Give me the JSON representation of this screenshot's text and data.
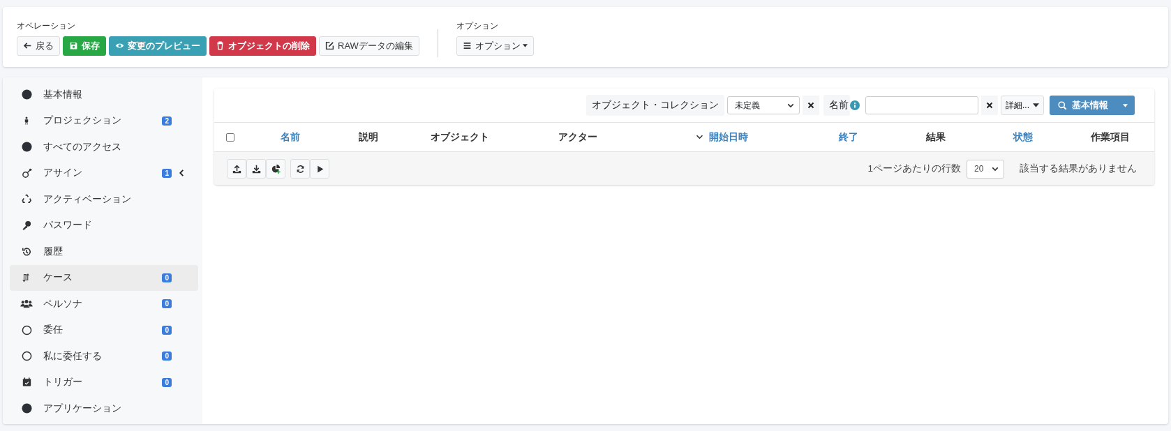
{
  "operations": {
    "label": "オペレーション",
    "buttons": [
      {
        "label": "戻る",
        "kind": "back"
      },
      {
        "label": "保存",
        "kind": "save"
      },
      {
        "label": "変更のプレビュー",
        "kind": "preview"
      },
      {
        "label": "オブジェクトの削除",
        "kind": "delete"
      },
      {
        "label": "RAWデータの編集",
        "kind": "edit"
      }
    ]
  },
  "options": {
    "label": "オプション",
    "button": "オプション"
  },
  "sidebar": {
    "items": [
      {
        "label": "基本情報",
        "selected": false
      },
      {
        "label": "プロジェクション",
        "selected": false,
        "badge": "2"
      },
      {
        "label": "すべてのアクセス",
        "selected": false
      },
      {
        "label": "アサイン",
        "selected": false,
        "badge": "1",
        "expanded": false
      },
      {
        "label": "アクティベーション",
        "selected": false
      },
      {
        "label": "パスワード",
        "selected": false
      },
      {
        "label": "履歴",
        "selected": false
      },
      {
        "label": "ケース",
        "selected": true,
        "badge": "0"
      },
      {
        "label": "ペルソナ",
        "selected": false,
        "badge": "0"
      },
      {
        "label": "委任",
        "selected": false,
        "badge": "0"
      },
      {
        "label": "私に委任する",
        "selected": false,
        "badge": "0"
      },
      {
        "label": "トリガー",
        "selected": false,
        "badge": "0"
      },
      {
        "label": "アプリケーション",
        "selected": false
      }
    ]
  },
  "search": {
    "collection_label": "オブジェクト・コレクション",
    "collection_value": "未定義",
    "name_label": "名前",
    "more_button": "詳細...",
    "search_button": "基本情報"
  },
  "table": {
    "select_all_checked": false,
    "columns": [
      {
        "label": "名前",
        "sortable": true,
        "sorted": false
      },
      {
        "label": "説明",
        "sortable": false,
        "sorted": false
      },
      {
        "label": "オブジェクト",
        "sortable": false,
        "sorted": false
      },
      {
        "label": "アクター",
        "sortable": false,
        "sorted": false
      },
      {
        "label": "開始日時",
        "sortable": true,
        "sorted": true
      },
      {
        "label": "終了",
        "sortable": true,
        "sorted": false
      },
      {
        "label": "結果",
        "sortable": false,
        "sorted": false
      },
      {
        "label": "状態",
        "sortable": true,
        "sorted": false
      },
      {
        "label": "作業項目",
        "sortable": false,
        "sorted": false
      }
    ]
  },
  "footer": {
    "rows_label": "1ページあたりの行数",
    "rows_value": "20",
    "empty_message": "該当する結果がありません"
  }
}
